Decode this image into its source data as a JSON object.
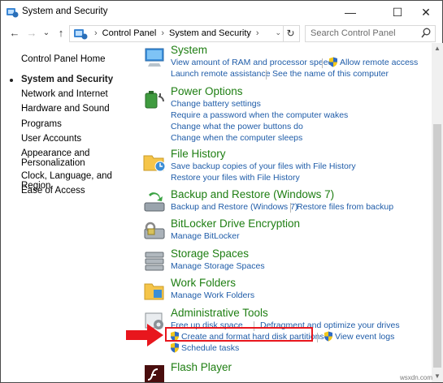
{
  "window": {
    "title": "System and Security",
    "minimize_glyph": "—",
    "maximize_glyph": "☐",
    "close_glyph": "✕"
  },
  "nav": {
    "back_glyph": "←",
    "forward_glyph": "→",
    "recent_glyph": "⌄",
    "up_glyph": "↑"
  },
  "address": {
    "breadcrumbs": [
      "Control Panel",
      "System and Security"
    ],
    "separator": "›",
    "dropdown_glyph": "⌄",
    "refresh_glyph": "↻"
  },
  "search": {
    "placeholder": "Search Control Panel"
  },
  "sidebar": {
    "home": "Control Panel Home",
    "items": [
      {
        "label": "System and Security",
        "current": true
      },
      {
        "label": "Network and Internet"
      },
      {
        "label": "Hardware and Sound"
      },
      {
        "label": "Programs"
      },
      {
        "label": "User Accounts"
      },
      {
        "label": "Appearance and Personalization"
      },
      {
        "label": "Clock, Language, and Region"
      },
      {
        "label": "Ease of Access"
      }
    ]
  },
  "categories": {
    "system": {
      "title": "System",
      "links": [
        "View amount of RAM and processor speed",
        "Allow remote access",
        "Launch remote assistance",
        "See the name of this computer"
      ]
    },
    "power": {
      "title": "Power Options",
      "links": [
        "Change battery settings",
        "Require a password when the computer wakes",
        "Change what the power buttons do",
        "Change when the computer sleeps"
      ]
    },
    "file_history": {
      "title": "File History",
      "links": [
        "Save backup copies of your files with File History",
        "Restore your files with File History"
      ]
    },
    "backup": {
      "title": "Backup and Restore (Windows 7)",
      "links": [
        "Backup and Restore (Windows 7)",
        "Restore files from backup"
      ]
    },
    "bitlocker": {
      "title": "BitLocker Drive Encryption",
      "links": [
        "Manage BitLocker"
      ]
    },
    "storage": {
      "title": "Storage Spaces",
      "links": [
        "Manage Storage Spaces"
      ]
    },
    "work_folders": {
      "title": "Work Folders",
      "links": [
        "Manage Work Folders"
      ]
    },
    "admin": {
      "title": "Administrative Tools",
      "links": [
        "Free up disk space",
        "Defragment and optimize your drives",
        "Create and format hard disk partitions",
        "View event logs",
        "Schedule tasks"
      ]
    },
    "flash": {
      "title": "Flash Player"
    }
  },
  "scroll": {
    "up_glyph": "▲",
    "down_glyph": "▼"
  },
  "watermark": "wsxdn.com",
  "colors": {
    "category_title": "#1e7e12",
    "link": "#1f5ca8",
    "highlight": "#e8161d"
  }
}
